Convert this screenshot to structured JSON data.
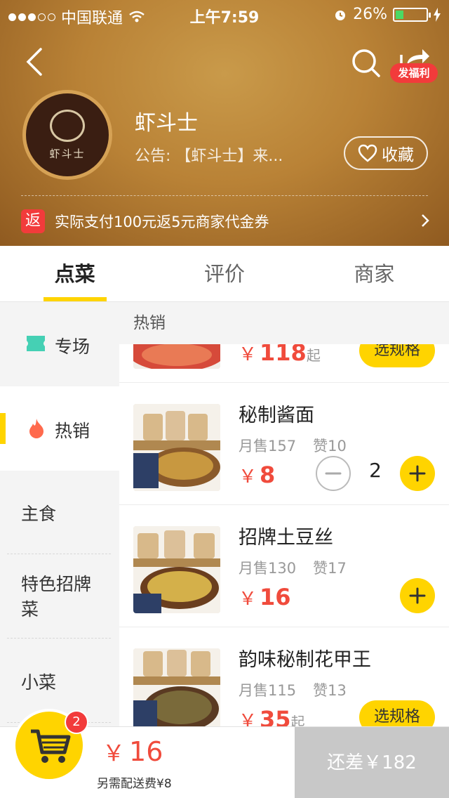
{
  "status_bar": {
    "carrier": "中国联通",
    "time": "上午7:59",
    "battery": "26%",
    "battery_level": 0.26,
    "signal_bars": 3
  },
  "nav": {
    "fuli_badge": "发福利"
  },
  "shop": {
    "name": "虾斗士",
    "logo_text": "虾斗士",
    "notice": "公告: 【虾斗士】来...",
    "favorite_label": "收藏",
    "promo_icon": "返",
    "promo_text": "实际支付100元返5元商家代金券"
  },
  "tabs": [
    {
      "label": "点菜",
      "active": true
    },
    {
      "label": "评价",
      "active": false
    },
    {
      "label": "商家",
      "active": false
    }
  ],
  "sidebar": {
    "categories": [
      {
        "label": "专场",
        "icon": "ticket-icon"
      },
      {
        "label": "热销",
        "icon": "flame-icon",
        "active": true
      },
      {
        "label": "主食"
      },
      {
        "label": "特色招牌菜"
      },
      {
        "label": "小菜"
      }
    ],
    "special_label_line1": "特色招牌",
    "special_label_line2": "菜"
  },
  "menu": {
    "section_title": "热销",
    "items": [
      {
        "name": "",
        "price": "118",
        "price_suffix": "起",
        "action": "选规格"
      },
      {
        "name": "秘制酱面",
        "monthly_sales": "月售157",
        "likes": "赞10",
        "price": "8",
        "quantity": "2"
      },
      {
        "name": "招牌土豆丝",
        "monthly_sales": "月售130",
        "likes": "赞17",
        "price": "16"
      },
      {
        "name": "韵味秘制花甲王",
        "monthly_sales": "月售115",
        "likes": "赞13",
        "price": "35",
        "price_suffix": "起",
        "action": "选规格"
      }
    ],
    "currency": "￥"
  },
  "cart": {
    "badge_count": "2",
    "total": "16",
    "delivery_fee_note": "另需配送费¥8",
    "checkout_label": "还差￥182"
  },
  "colors": {
    "accent_yellow": "#ffd400",
    "price_red": "#f04b3c",
    "badge_red": "#f23b3b",
    "header_brown": "#b98236"
  }
}
